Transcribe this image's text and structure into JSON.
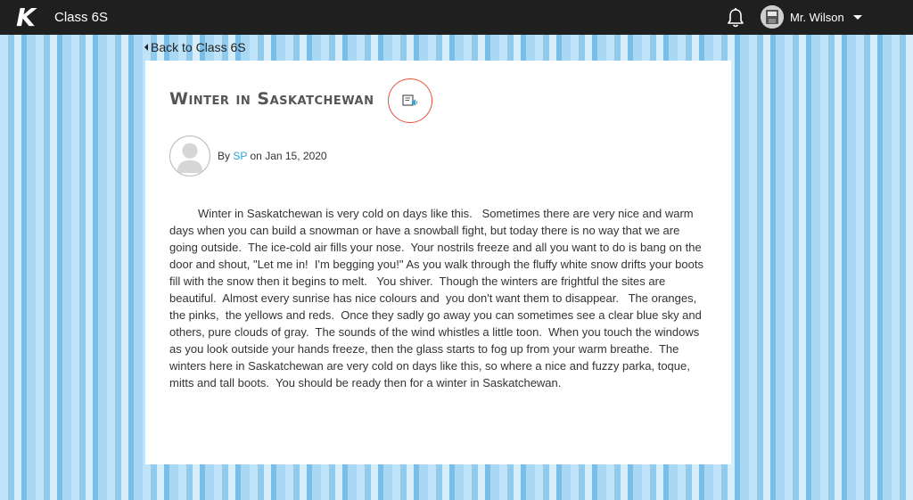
{
  "topbar": {
    "logo": "K",
    "class_name": "Class 6S",
    "user_name": "Mr. Wilson"
  },
  "nav": {
    "back_label": "Back to Class 6S"
  },
  "post": {
    "title": "Winter in Saskatchewan",
    "by_prefix": "By",
    "author": "SP",
    "date_prefix": "on",
    "date": "Jan 15, 2020",
    "body": "Winter in Saskatchewan is very cold on days like this.   Sometimes there are very nice and warm days when you can build a snowman or have a snowball fight, but today there is no way that we are going outside.  The ice-cold air fills your nose.  Your nostrils freeze and all you want to do is bang on the door and shout, \"Let me in!  I'm begging you!\" As you walk through the fluffy white snow drifts your boots fill with the snow then it begins to melt.   You shiver.  Though the winters are frightful the sites are beautiful.  Almost every sunrise has nice colours and  you don't want them to disappear.   The oranges, the pinks,  the yellows and reds.  Once they sadly go away you can sometimes see a clear blue sky and others, pure clouds of gray.  The sounds of the wind whistles a little toon.  When you touch the windows as you look outside your hands freeze, then the glass starts to fog up from your warm breathe.  The winters here in Saskatchewan are very cold on days like this, so where a nice and fuzzy parka, toque, mitts and tall boots.  You should be ready then for a winter in Saskatchewan."
  },
  "icons": {
    "bell": "bell-icon",
    "listen": "text-to-speech-icon",
    "caret": "caret-down-icon"
  },
  "colors": {
    "topbar": "#1f1f1f",
    "author_link": "#2aa6d7",
    "listen_ring": "#e5533d"
  }
}
